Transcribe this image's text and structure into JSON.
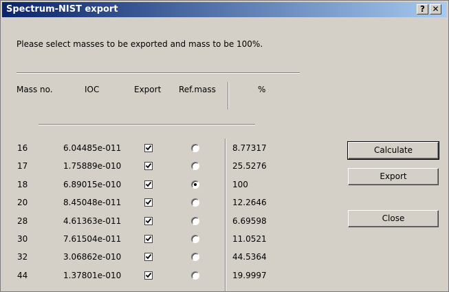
{
  "window": {
    "title": "Spectrum-NIST export",
    "help_glyph": "?",
    "close_glyph": "✕"
  },
  "prompt": "Please select masses to be exported and mass to be 100%.",
  "table": {
    "headers": {
      "mass": "Mass no.",
      "ioc": "IOC",
      "export": "Export",
      "refmass": "Ref.mass",
      "percent": "%"
    },
    "rows": [
      {
        "mass": "16",
        "ioc": "6.04485e-011",
        "export": true,
        "ref": false,
        "percent": "8.77317"
      },
      {
        "mass": "17",
        "ioc": "1.75889e-010",
        "export": true,
        "ref": false,
        "percent": "25.5276"
      },
      {
        "mass": "18",
        "ioc": "6.89015e-010",
        "export": true,
        "ref": true,
        "percent": "100"
      },
      {
        "mass": "20",
        "ioc": "8.45048e-011",
        "export": true,
        "ref": false,
        "percent": "12.2646"
      },
      {
        "mass": "28",
        "ioc": "4.61363e-011",
        "export": true,
        "ref": false,
        "percent": "6.69598"
      },
      {
        "mass": "30",
        "ioc": "7.61504e-011",
        "export": true,
        "ref": false,
        "percent": "11.0521"
      },
      {
        "mass": "32",
        "ioc": "3.06862e-010",
        "export": true,
        "ref": false,
        "percent": "44.5364"
      },
      {
        "mass": "44",
        "ioc": "1.37801e-010",
        "export": true,
        "ref": false,
        "percent": "19.9997"
      }
    ]
  },
  "buttons": {
    "calculate": "Calculate",
    "export": "Export",
    "close": "Close"
  }
}
